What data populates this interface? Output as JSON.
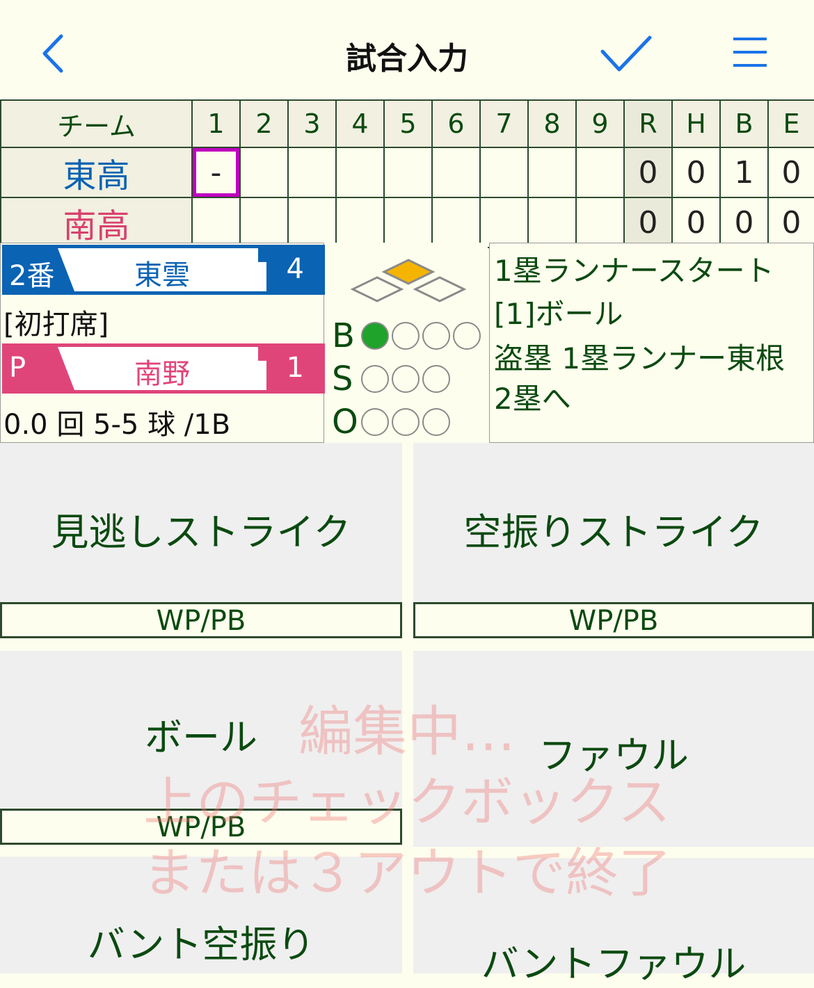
{
  "header": {
    "title": "試合入力",
    "back_icon": "chevron-left-icon",
    "confirm_icon": "checkmark-icon",
    "menu_icon": "hamburger-menu-icon"
  },
  "scoreboard": {
    "team_header": "チーム",
    "innings": [
      "1",
      "2",
      "3",
      "4",
      "5",
      "6",
      "7",
      "8",
      "9"
    ],
    "totals_headers": [
      "R",
      "H",
      "B",
      "E"
    ],
    "teams": [
      {
        "name": "東高",
        "color": "#0a63b3",
        "innings": [
          "-",
          "",
          "",
          "",
          "",
          "",
          "",
          "",
          ""
        ],
        "totals": [
          "0",
          "0",
          "1",
          "0"
        ]
      },
      {
        "name": "南高",
        "color": "#d9406f",
        "innings": [
          "",
          "",
          "",
          "",
          "",
          "",
          "",
          "",
          ""
        ],
        "totals": [
          "0",
          "0",
          "0",
          "0"
        ]
      }
    ],
    "current_inning_marker_color": "#c000c0"
  },
  "batter": {
    "order": "2番",
    "name": "東雲",
    "position": "4",
    "note": "[初打席]"
  },
  "pitcher": {
    "label": "P",
    "name": "南野",
    "number": "1",
    "stats": "0.0 回 5-5 球 /1B"
  },
  "count": {
    "balls_label": "B",
    "strikes_label": "S",
    "outs_label": "O",
    "balls": 1,
    "balls_max": 4,
    "strikes": 0,
    "strikes_max": 3,
    "outs": 0,
    "outs_max": 3
  },
  "bases": {
    "first": false,
    "second": true,
    "third": false,
    "occupied_color": "#f5b400"
  },
  "play_log": [
    "1塁ランナースタート",
    "[1]ボール",
    "盗塁 1塁ランナー東根",
    "2塁へ"
  ],
  "actions": {
    "called_strike": "見逃しストライク",
    "swinging_strike": "空振りストライク",
    "ball": "ボール",
    "foul": "ファウル",
    "bunt_swing": "バント空振り",
    "bunt_foul": "バントファウル",
    "wp_pb": "WP/PB"
  },
  "overlay": {
    "line1": "編集中…",
    "line2": "上のチェックボックス",
    "line3": "または３アウトで終了"
  }
}
